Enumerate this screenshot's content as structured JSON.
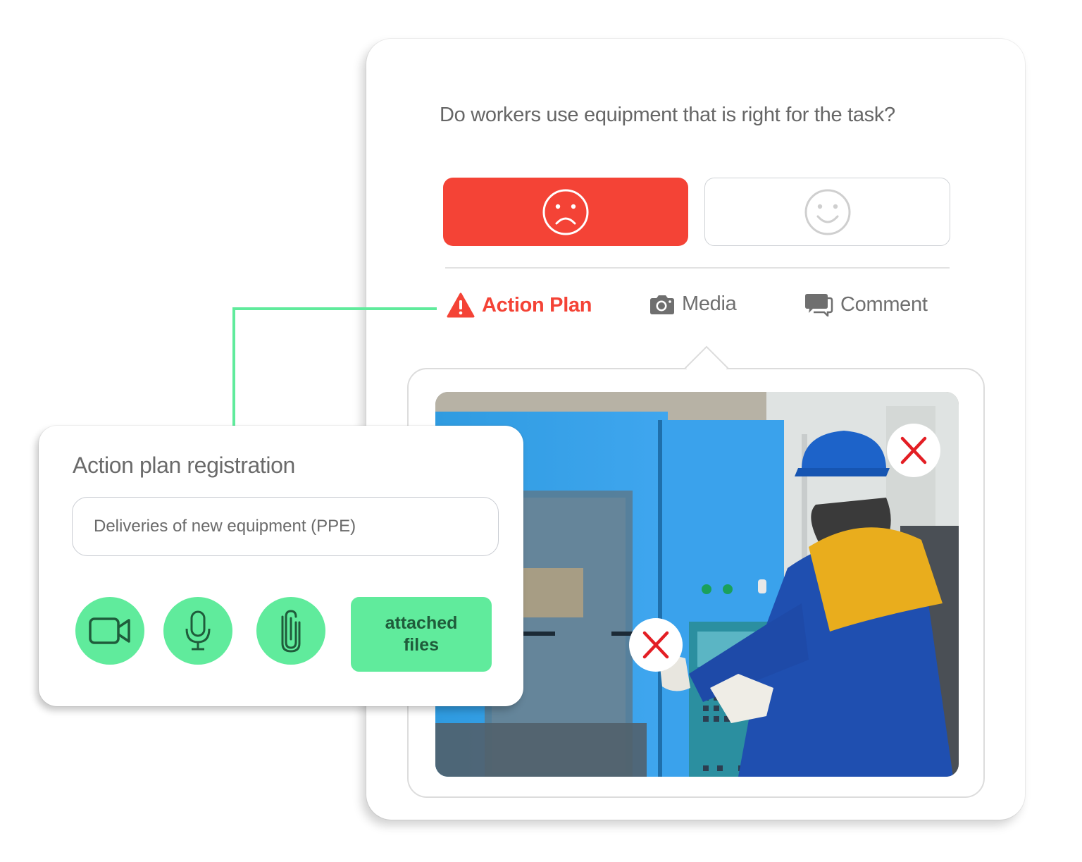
{
  "question": {
    "text": "Do workers use equipment that is right for the task?"
  },
  "answers": [
    {
      "id": "no",
      "icon": "sad-face-icon",
      "selected": true,
      "color": "#f44336"
    },
    {
      "id": "yes",
      "icon": "happy-face-icon",
      "selected": false,
      "color": "#ffffff"
    }
  ],
  "tabs": [
    {
      "label": "Action Plan",
      "icon": "warning-triangle-icon",
      "active": true,
      "color": "#f44336"
    },
    {
      "label": "Media",
      "icon": "camera-icon",
      "active": false,
      "color": "#6f6f6f"
    },
    {
      "label": "Comment",
      "icon": "chat-bubbles-icon",
      "active": false,
      "color": "#6f6f6f"
    }
  ],
  "media": {
    "photo_description": "Worker in blue cap and blue/yellow jacket operating a blue industrial machine control panel",
    "markers": [
      {
        "icon": "x-mark-icon",
        "label": "X",
        "color": "#e31e24"
      },
      {
        "icon": "x-mark-icon",
        "label": "X",
        "color": "#e31e24"
      }
    ]
  },
  "action_plan": {
    "title": "Action plan registration",
    "input_value": "Deliveries of new equipment (PPE)",
    "buttons": [
      {
        "icon": "video-camera-icon",
        "name": "record-video"
      },
      {
        "icon": "microphone-icon",
        "name": "record-audio"
      },
      {
        "icon": "paperclip-icon",
        "name": "attach-file"
      }
    ],
    "files_button_label_line1": "attached",
    "files_button_label_line2": "files",
    "accent_color": "#60eb9c"
  }
}
